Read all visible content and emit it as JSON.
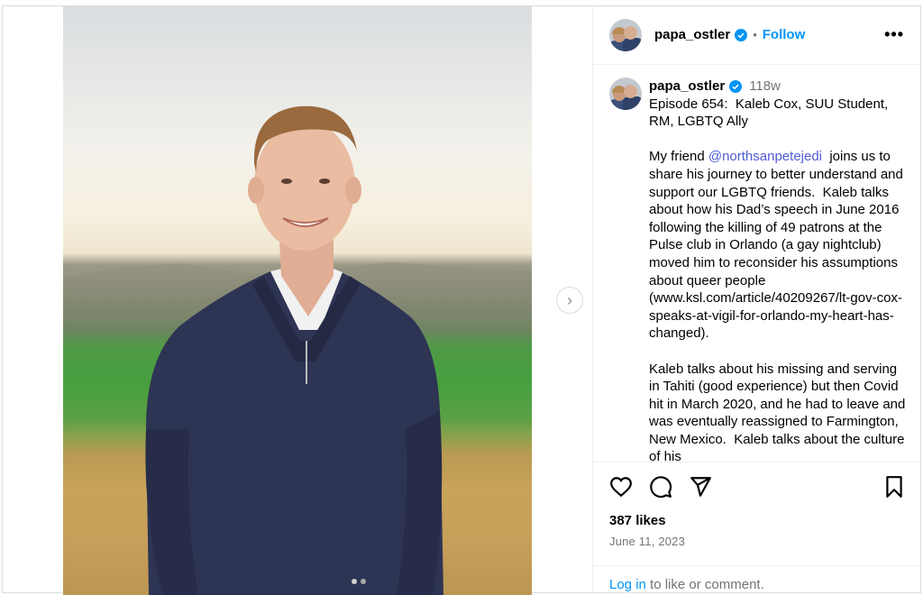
{
  "header": {
    "username": "papa_ostler",
    "separator": "•",
    "follow_label": "Follow",
    "more_label": "•••"
  },
  "caption": {
    "username": "papa_ostler",
    "age": "118w",
    "text_before_mention": "Episode 654:  Kaleb Cox, SUU Student, RM, LGBTQ Ally\n\nMy friend ",
    "mention": "@northsanpetejedi",
    "text_after_mention": "  joins us to share his journey to better understand and support our LGBTQ friends.  Kaleb talks about how his Dad’s speech in June 2016 following the killing of 49 patrons at the Pulse club in Orlando (a gay nightclub) moved him to reconsider his assumptions about queer people (www.ksl.com/article/40209267/lt-gov-cox-speaks-at-vigil-for-orlando-my-heart-has-changed).\n\nKaleb talks about his missing and serving in Tahiti (good experience) but then Covid hit in March 2020, and he had to leave and was eventually reassigned to Farmington, New Mexico.  Kaleb talks about the culture of his"
  },
  "actions": {
    "likes": "387 likes",
    "date": "June 11, 2023",
    "login_link": "Log in",
    "login_text": " to like or comment."
  },
  "media": {
    "next_glyph": "›",
    "carousel_count": 2,
    "active_index": 1
  },
  "colors": {
    "accent": "#0095f6",
    "mention": "#4f5bd5",
    "secondary_text": "#737373",
    "verified": "#0095f6"
  },
  "icons": [
    "heart-icon",
    "comment-icon",
    "share-icon",
    "bookmark-icon",
    "verified-badge-icon",
    "more-icon",
    "chevron-right-icon"
  ]
}
